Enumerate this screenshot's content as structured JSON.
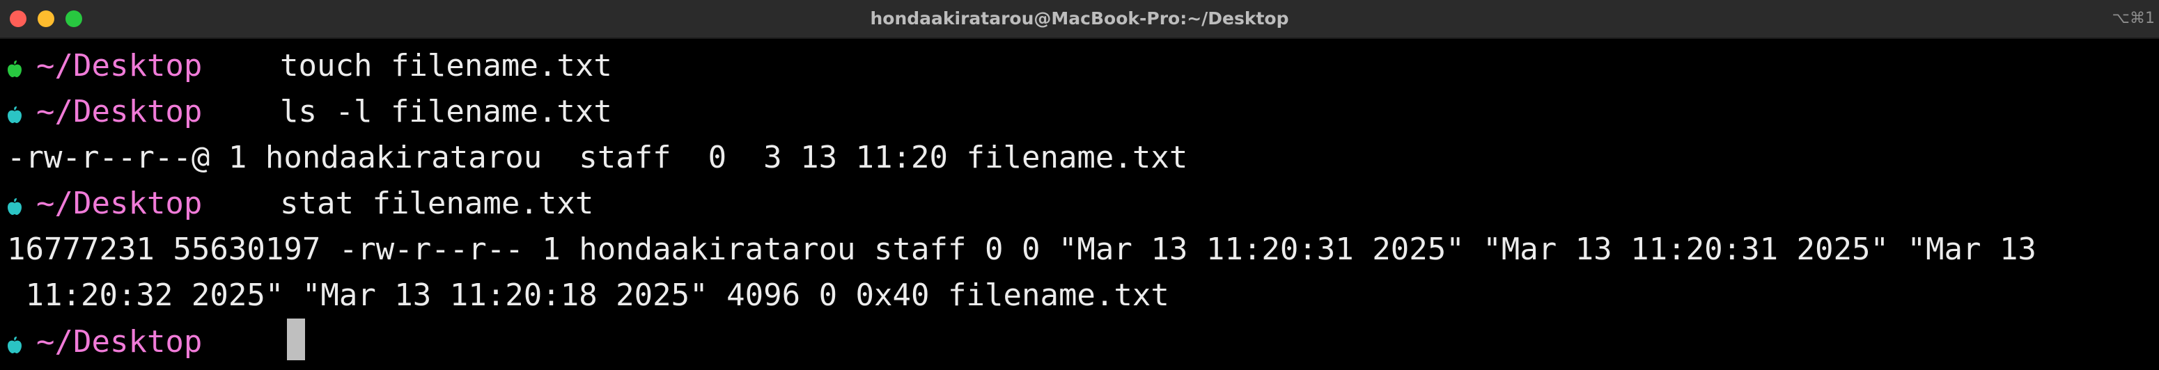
{
  "window": {
    "title": "hondaakiratarou@MacBook-Pro:~/Desktop",
    "shortcut_hint": "⌥⌘1"
  },
  "colors": {
    "background": "#000000",
    "titlebar": "#2b2b2b",
    "prompt_path": "#f07bd8",
    "text": "#ececec",
    "apple_success": "#28c840",
    "apple_default": "#2bc4c4"
  },
  "prompt": {
    "path": "~/Desktop",
    "icon": "apple-icon"
  },
  "terminal": {
    "commands": [
      "touch filename.txt",
      "ls -l filename.txt",
      "stat filename.txt"
    ],
    "outputs": {
      "ls": "-rw-r--r--@ 1 hondaakiratarou  staff  0  3 13 11:20 filename.txt",
      "stat_line1": "16777231 55630197 -rw-r--r-- 1 hondaakiratarou staff 0 0 \"Mar 13 11:20:31 2025\" \"Mar 13 11:20:31 2025\" \"Mar 13",
      "stat_line2": " 11:20:32 2025\" \"Mar 13 11:20:18 2025\" 4096 0 0x40 filename.txt"
    }
  }
}
